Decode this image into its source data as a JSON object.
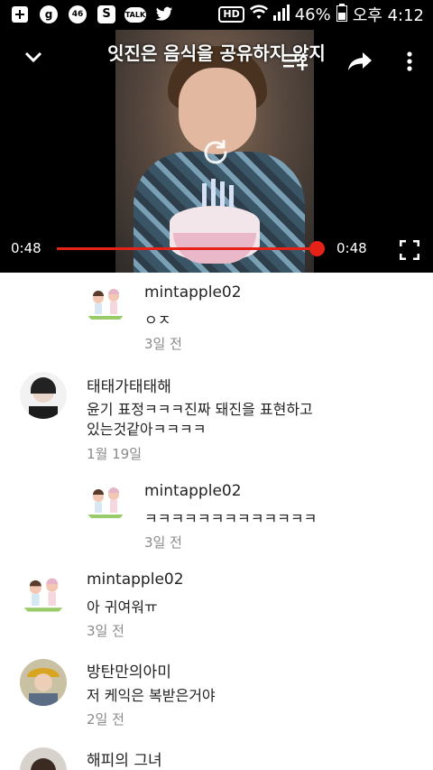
{
  "status_bar": {
    "icons": [
      "plus-box-icon",
      "g-circle-icon",
      "46-circle-icon",
      "s-square-icon",
      "talk-bubble-icon",
      "twitter-icon"
    ],
    "g_label": "g",
    "n46_label": "46",
    "s_label": "S",
    "talk_label": "TALK",
    "hd_label": "HD",
    "battery_percent": "46%",
    "time": "오후 4:12"
  },
  "video": {
    "caption": "잇진은 음식을 공유하지 않지",
    "time_current": "0:48",
    "time_total": "0:48",
    "progress": 1.0,
    "accent_color": "#e62117"
  },
  "comments": [
    {
      "author": "mintapple02",
      "text": "ㅇㅈ",
      "time": "3일 전",
      "reply": true,
      "avatar": "mint-avatar"
    },
    {
      "author": "태태가태태해",
      "text_lines": [
        "윤기 표정ㅋㅋㅋ진짜 돼진을 표현하고",
        "있는것같아ㅋㅋㅋㅋ"
      ],
      "time": "1월 19일",
      "reply": false,
      "avatar": "taetae-avatar"
    },
    {
      "author": "mintapple02",
      "text": "ㅋㅋㅋㅋㅋㅋㅋㅋㅋㅋㅋㅋㅋ",
      "time": "3일 전",
      "reply": true,
      "avatar": "mint-avatar"
    },
    {
      "author": "mintapple02",
      "text": "아 귀여워ㅠ",
      "time": "3일 전",
      "reply": false,
      "avatar": "mint-avatar"
    },
    {
      "author": "방탄만의아미",
      "text": "저 케익은 복받은거야",
      "time": "2일 전",
      "reply": false,
      "avatar": "army-avatar"
    },
    {
      "author": "해피의 그녀",
      "reply": false,
      "avatar": "happy-avatar"
    }
  ]
}
